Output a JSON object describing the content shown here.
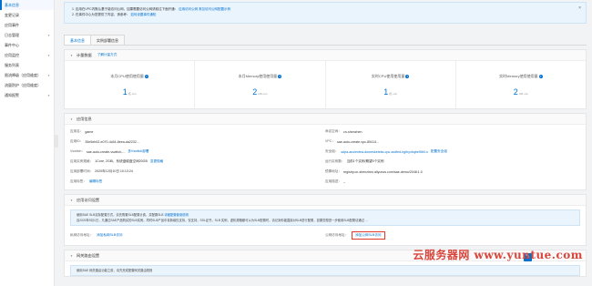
{
  "sidebar": {
    "items": [
      {
        "label": "基本信息",
        "active": true,
        "chevron": false
      },
      {
        "label": "变更记录",
        "active": false,
        "chevron": false
      },
      {
        "label": "应用事件",
        "active": false,
        "chevron": false
      },
      {
        "label": "日志管理",
        "active": false,
        "chevron": true
      },
      {
        "label": "事件中心",
        "active": false,
        "chevron": false
      },
      {
        "label": "应用监控",
        "active": false,
        "chevron": true
      },
      {
        "label": "服务列表",
        "active": false,
        "chevron": false
      },
      {
        "label": "限流降级（应用维度）",
        "active": false,
        "chevron": true
      },
      {
        "label": "流量防护（应用维度）",
        "active": false,
        "chevron": false
      },
      {
        "label": "通知报警",
        "active": false,
        "chevron": true
      }
    ]
  },
  "notice": {
    "line1": "1. 应用在VPC内默认基于能访问公网，如果需要访问公网请前往下面开通：",
    "line1_link1": "应用访问公网",
    "line1_link2": "常见访问公网配置示例",
    "line2": "2. 在事件中心为您提供了内容、请参考：",
    "line2_link": "如何设置事件通知",
    "close_icon": "close-icon"
  },
  "tabs": [
    {
      "label": "基本信息",
      "active": true
    },
    {
      "label": "实例部署信息",
      "active": false
    }
  ],
  "metering": {
    "title": "计量数据",
    "link": "了解计量方式",
    "metrics": [
      {
        "label": "本月CPU使用使用量",
        "value": "1",
        "unit": "核·min"
      },
      {
        "label": "本月Memory使用使用量",
        "value": "2",
        "unit": "GB·min"
      },
      {
        "label": "实时CPU使用使用量",
        "value": "1",
        "unit": "核·min"
      },
      {
        "label": "实时Memory使用使用量",
        "value": "2",
        "unit": "GB·min"
      }
    ]
  },
  "app_info": {
    "title": "应用信息",
    "rows": [
      {
        "k": "应用名：",
        "v": "game",
        "a": ""
      },
      {
        "k": "命名空间：",
        "v": "cn-shenzhen",
        "a": ""
      },
      {
        "k": "应用ID：",
        "v": "35e5eb02-e070-4c54-8eea-da2232...",
        "a": ""
      },
      {
        "k": "VPC：",
        "v": "sae-auto-create-vpc-85414...",
        "a": ""
      },
      {
        "k": "Vswitch：",
        "v": "sae-auto-create-vswitch-...",
        "a": "多Vswitch部署"
      },
      {
        "k": "安全组：",
        "v": "",
        "a": "sdpa-ancientea-domesketeks-cpu-ssdfed-hgthyxbqbe5fl4f-n",
        "a2": "配置安全组"
      },
      {
        "k": "应用实例规格：",
        "v": "1Core, 2GiB，系统盘磁盘空间20GB",
        "a": "变更规格"
      },
      {
        "k": "运行实例数：",
        "v": "当前1个实例/期望0个实例",
        "a": ""
      },
      {
        "k": "应用部署时间：",
        "v": "2020年12月10日 10:13:24",
        "a": ""
      },
      {
        "k": "镜像地址：",
        "v": "registry.cn-shenzhen.aliyuncs.com/sae-demo/2048:1.0",
        "a": ""
      },
      {
        "k": "应用标签：",
        "v": "",
        "a": "编辑标签"
      },
      {
        "k": "应用描述：",
        "v": "--",
        "a": ""
      }
    ]
  },
  "access": {
    "title": "应用访问设置",
    "tip1_pre": "使用SAE SLB实际配置方式，请先购置SLB配置计费，并配置SLB",
    "tip1_link": "详细配置使用说明",
    "tip2": "自2020年9月1日，凡通过SAE产品购买的SLB实例，同时SLB产品中将新增仅支持，仅支持，SSL证书，SLB 实例，虚机规格都可以为SLB配置时，请记到你能直接对SLB进行配置，如果您想进一步使用SLB配置请通过 ...",
    "private_label": "私网访问地址：",
    "private_link": "添加私网SLB访问",
    "public_label": "公网访问地址：",
    "public_link": "添加公网SLB访问"
  },
  "gateway": {
    "title": "网关路由设置",
    "tip": "使用SAE 网关路由功能之前，请先完成配置网关路由规则"
  },
  "watermark": "云服务器网 www.yuntue.com",
  "colors": {
    "accent": "#0070cc",
    "highlight": "#e03b2a"
  }
}
